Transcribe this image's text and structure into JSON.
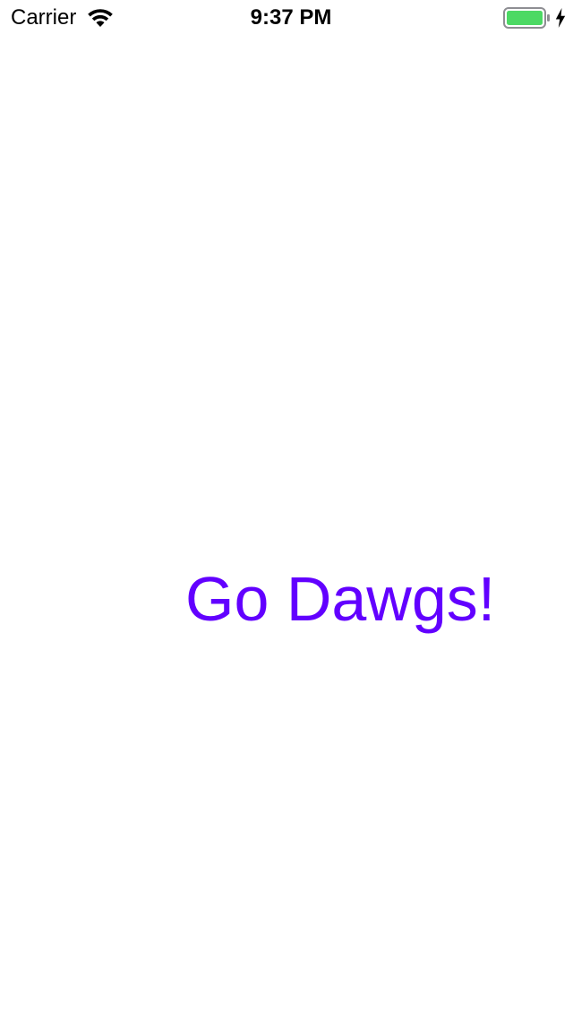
{
  "status_bar": {
    "carrier": "Carrier",
    "time": "9:37 PM",
    "wifi_icon": "wifi-icon",
    "battery_icon": "battery-icon",
    "charging_icon": "lightning-bolt-icon",
    "battery_color": "#4cd964",
    "battery_level": 1.0
  },
  "main": {
    "label": "Go Dawgs!",
    "label_color": "#6200ff"
  }
}
